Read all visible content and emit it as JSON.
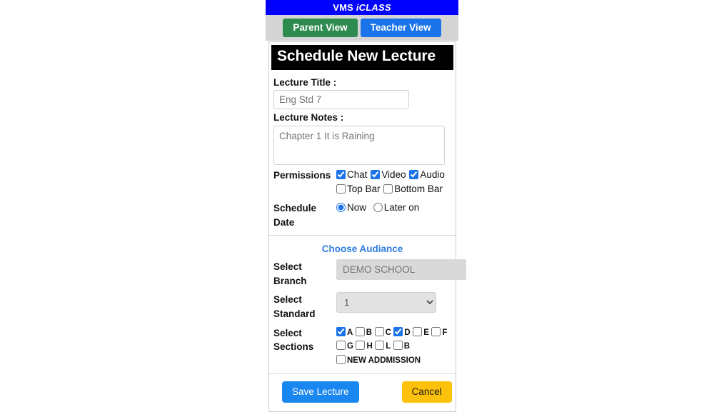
{
  "brand": {
    "name": "VMS",
    "product": "iCLASS"
  },
  "views": {
    "parent_label": "Parent View",
    "teacher_label": "Teacher View"
  },
  "card": {
    "title": "Schedule New Lecture",
    "lecture_title": {
      "label": "Lecture Title :",
      "value": "",
      "placeholder": "Eng Std 7"
    },
    "lecture_notes": {
      "label": "Lecture Notes :",
      "value": "",
      "placeholder": "Chapter 1 It is Raining"
    },
    "permissions": {
      "label": "Permissions",
      "options": [
        {
          "label": "Chat",
          "checked": true
        },
        {
          "label": "Video",
          "checked": true
        },
        {
          "label": "Audio",
          "checked": true
        },
        {
          "label": "Top Bar",
          "checked": false
        },
        {
          "label": "Bottom Bar",
          "checked": false
        }
      ]
    },
    "schedule": {
      "label": "Schedule Date",
      "options": [
        {
          "label": "Now",
          "selected": true
        },
        {
          "label": "Later on",
          "selected": false
        }
      ]
    },
    "audience": {
      "heading": "Choose Audiance",
      "branch": {
        "label": "Select Branch",
        "value": "DEMO SCHOOL",
        "placeholder": "DEMO SCHOOL"
      },
      "standard": {
        "label": "Select Standard",
        "value": "1",
        "options": [
          "1"
        ]
      },
      "sections": {
        "label": "Select Sections",
        "options": [
          {
            "label": "A",
            "checked": true
          },
          {
            "label": "B",
            "checked": false
          },
          {
            "label": "C",
            "checked": false
          },
          {
            "label": "D",
            "checked": true
          },
          {
            "label": "E",
            "checked": false
          },
          {
            "label": "F",
            "checked": false
          },
          {
            "label": "G",
            "checked": false
          },
          {
            "label": "H",
            "checked": false
          },
          {
            "label": "L",
            "checked": false
          },
          {
            "label": "B",
            "checked": false
          },
          {
            "label": "NEW ADDMISSION",
            "checked": false
          }
        ]
      }
    },
    "actions": {
      "save_label": "Save Lecture",
      "cancel_label": "Cancel"
    }
  },
  "colors": {
    "brand_bar": "#0000ff",
    "parent_view": "#2e8b4f",
    "teacher_view": "#1a73e8",
    "accent_link": "#2f7de1",
    "save": "#1a86f0",
    "cancel": "#fcc10a"
  }
}
